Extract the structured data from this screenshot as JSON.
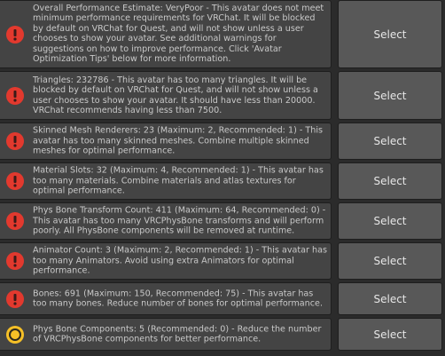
{
  "colors": {
    "panel_bg": "#2b2b2b",
    "message_bg": "#444444",
    "button_bg": "#585858",
    "error_red": "#e2392e",
    "warning_yellow": "#f6c027",
    "text": "#c9c9c9"
  },
  "warnings": [
    {
      "severity": "error",
      "icon": "error-icon",
      "text": "Overall Performance Estimate: VeryPoor - This avatar does not meet minimum performance requirements for VRChat. It will be blocked by default on VRChat for Quest, and will not show unless a user chooses to show your avatar. See additional warnings for suggestions on how to improve performance. Click 'Avatar Optimization Tips' below for more information.",
      "button": "Select"
    },
    {
      "severity": "error",
      "icon": "error-icon",
      "text": "Triangles: 232786 - This avatar has too many triangles. It will be blocked by default on VRChat for Quest, and will not show unless a user chooses to show your avatar. It should have less than 20000. VRChat recommends having less than 7500.",
      "button": "Select"
    },
    {
      "severity": "error",
      "icon": "error-icon",
      "text": "Skinned Mesh Renderers: 23 (Maximum: 2, Recommended: 1) - This avatar has too many skinned meshes. Combine multiple skinned meshes for optimal performance.",
      "button": "Select"
    },
    {
      "severity": "error",
      "icon": "error-icon",
      "text": "Material Slots: 32 (Maximum: 4, Recommended: 1) - This avatar has too many materials. Combine materials and atlas textures for optimal performance.",
      "button": "Select"
    },
    {
      "severity": "error",
      "icon": "error-icon",
      "text": "Phys Bone Transform Count: 411 (Maximum: 64, Recommended: 0) - This avatar has too many VRCPhysBone transforms and will perform poorly. All PhysBone components will be removed at runtime.",
      "button": "Select"
    },
    {
      "severity": "error",
      "icon": "error-icon",
      "text": "Animator Count: 3 (Maximum: 2, Recommended: 1) - This avatar has too many Animators. Avoid using extra Animators for optimal performance.",
      "button": "Select"
    },
    {
      "severity": "error",
      "icon": "error-icon",
      "text": "Bones: 691 (Maximum: 150, Recommended: 75) - This avatar has too many bones. Reduce number of bones for optimal performance.",
      "button": "Select"
    },
    {
      "severity": "warning",
      "icon": "warning-icon",
      "text": "Phys Bone Components: 5 (Recommended: 0) - Reduce the number of VRCPhysBone components for better performance.",
      "button": "Select"
    }
  ]
}
